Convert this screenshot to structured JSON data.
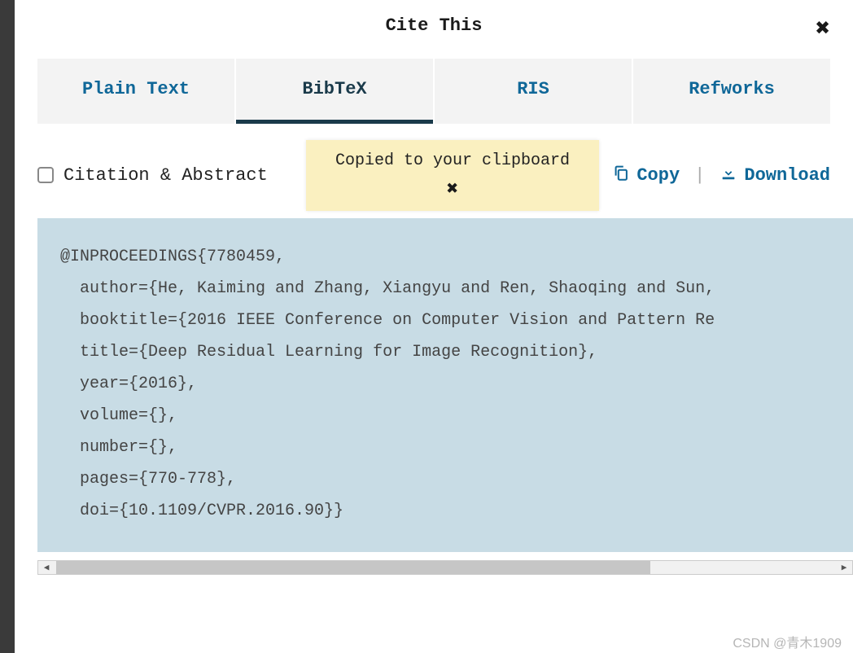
{
  "modal": {
    "title": "Cite This",
    "close_glyph": "✖"
  },
  "tabs": [
    {
      "label": "Plain Text",
      "active": false
    },
    {
      "label": "BibTeX",
      "active": true
    },
    {
      "label": "RIS",
      "active": false
    },
    {
      "label": "Refworks",
      "active": false
    }
  ],
  "toolbar": {
    "checkbox_label": "Citation & Abstract",
    "copy_label": "Copy",
    "download_label": "Download",
    "divider": "|"
  },
  "toast": {
    "message": "Copied to your clipboard",
    "close_glyph": "✖"
  },
  "citation_text": "@INPROCEEDINGS{7780459,\n  author={He, Kaiming and Zhang, Xiangyu and Ren, Shaoqing and Sun,\n  booktitle={2016 IEEE Conference on Computer Vision and Pattern Re\n  title={Deep Residual Learning for Image Recognition}, \n  year={2016},\n  volume={},\n  number={},\n  pages={770-778},\n  doi={10.1109/CVPR.2016.90}}",
  "scroll": {
    "left_arrow": "◀",
    "right_arrow": "▶"
  },
  "watermark": "CSDN @青木1909"
}
